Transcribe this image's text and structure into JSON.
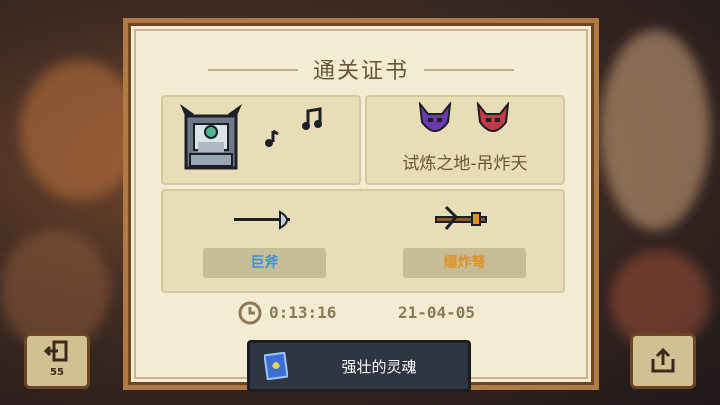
{
  "certificate": {
    "title": "通关证书",
    "character": {
      "icon": "knight-character-icon",
      "music_icon": "music-note-icon"
    },
    "boss": {
      "icons": [
        "purple-devil-icon",
        "red-devil-icon"
      ],
      "label": "试炼之地-吊炸天"
    },
    "weapons": [
      {
        "icon": "giant-axe-icon",
        "label": "巨斧",
        "color": "#3b8fd9"
      },
      {
        "icon": "explosive-crossbow-icon",
        "label": "爆炸弩",
        "color": "#e0922a"
      }
    ],
    "time": "0:13:16",
    "date": "21-04-05"
  },
  "buff": {
    "icon": "spell-card-icon",
    "label": "强壮的灵魂"
  },
  "exit_button": {
    "sub_label": "55"
  },
  "share_button": {
    "icon": "share-icon"
  }
}
